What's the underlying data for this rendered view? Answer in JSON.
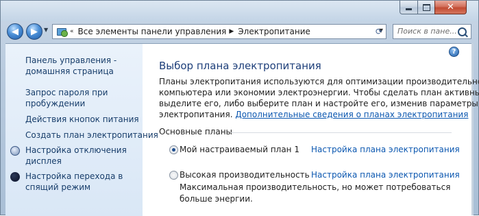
{
  "window": {
    "controls": {
      "minimize": "minimize",
      "maximize": "maximize",
      "close": "close"
    }
  },
  "nav": {
    "back_icon": "back-arrow-icon",
    "forward_icon": "forward-arrow-icon",
    "breadcrumb": [
      "Все элементы панели управления",
      "Электропитание"
    ],
    "search_placeholder": "Поиск в пане..."
  },
  "sidebar": {
    "items": [
      {
        "label_line1": "Панель управления -",
        "label_line2": "домашняя страница",
        "icon": ""
      },
      {
        "label_line1": "Запрос пароля при",
        "label_line2": "пробуждении",
        "icon": ""
      },
      {
        "label_line1": "Действия кнопок питания",
        "label_line2": "",
        "icon": ""
      },
      {
        "label_line1": "Создать план электропитания",
        "label_line2": "",
        "icon": ""
      },
      {
        "label_line1": "Настройка отключения",
        "label_line2": "дисплея",
        "icon": "clock-icon"
      },
      {
        "label_line1": "Настройка перехода в",
        "label_line2": "спящий режим",
        "icon": "moon-icon"
      }
    ]
  },
  "main": {
    "title": "Выбор плана электропитания",
    "description_lines": [
      "Планы электропитания используются для оптимизации производительности",
      "компьютера или экономии электроэнергии. Чтобы сделать план активным,",
      "выделите его, либо выберите план и настройте его, изменив параметры",
      "электропитания."
    ],
    "description_link": "Дополнительные сведения о планах электропитания",
    "section_title": "Основные планы",
    "plans": [
      {
        "name": "Мой настраиваемый план 1",
        "link": "Настройка плана электропитания",
        "selected": true,
        "desc_line1": "",
        "desc_line2": ""
      },
      {
        "name": "Высокая производительность",
        "link": "Настройка плана электропитания",
        "selected": false,
        "desc_line1": "Максимальная производительность, но может потребоваться",
        "desc_line2": "больше энергии."
      }
    ],
    "help_glyph": "?"
  },
  "colors": {
    "link": "#0b57b0",
    "heading": "#1e3f7a",
    "sidebar_link": "#173d6a",
    "sidebar_bg": "#e3edf9"
  }
}
